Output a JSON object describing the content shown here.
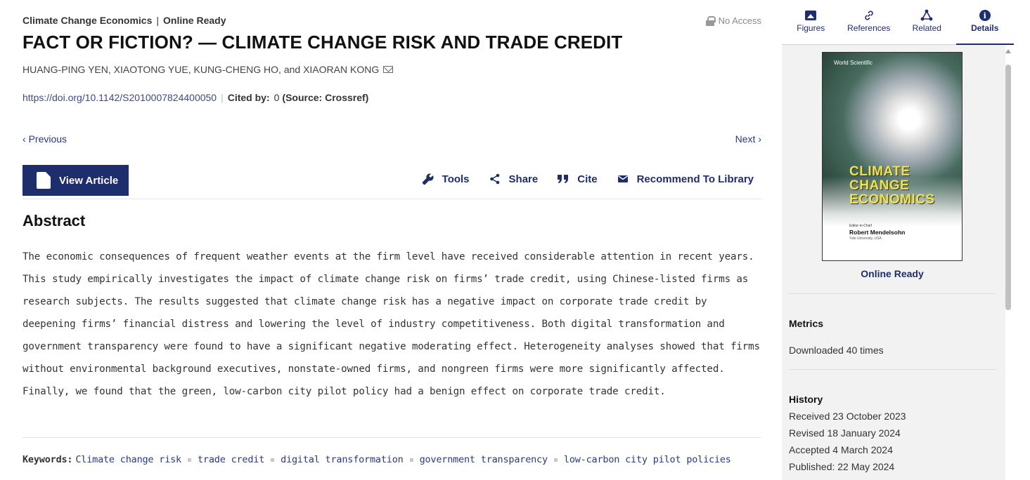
{
  "header": {
    "journal": "Climate Change Economics",
    "separator": "|",
    "status": "Online Ready",
    "access": "No Access"
  },
  "article": {
    "title": "FACT OR FICTION? — CLIMATE CHANGE RISK AND TRADE CREDIT",
    "authors": "HUANG-PING YEN, XIAOTONG YUE, KUNG-CHENG HO, and XIAORAN KONG",
    "doi": "https://doi.org/10.1142/S2010007824400050",
    "cited_by_label": "Cited by:",
    "cited_by_count": "0",
    "cited_by_source": "(Source: Crossref)"
  },
  "nav": {
    "previous": "Previous",
    "next": "Next"
  },
  "actions": {
    "view_article": "View Article",
    "tools": "Tools",
    "share": "Share",
    "cite": "Cite",
    "recommend": "Recommend To Library"
  },
  "abstract": {
    "heading": "Abstract",
    "text": "The economic consequences of frequent weather events at the firm level have received considerable attention in recent years. This study empirically investigates the impact of climate change risk on firms’ trade credit, using Chinese-listed firms as research subjects. The results suggested that climate change risk has a negative impact on corporate trade credit by deepening firms’ financial distress and lowering the level of industry competitiveness. Both digital transformation and government transparency were found to have a significant negative moderating effect. Heterogeneity analyses showed that firms without environmental background executives, nonstate-owned firms, and nongreen firms were more significantly affected. Finally, we found that the green, low-carbon city pilot policy had a benign effect on corporate trade credit."
  },
  "keywords": {
    "label": "Keywords:",
    "items": [
      "Climate change risk",
      "trade credit",
      "digital transformation",
      "government transparency",
      "low-carbon city pilot policies"
    ]
  },
  "sidebar": {
    "tabs": [
      {
        "label": "Figures",
        "icon": "image-icon"
      },
      {
        "label": "References",
        "icon": "link-icon"
      },
      {
        "label": "Related",
        "icon": "network-icon"
      },
      {
        "label": "Details",
        "icon": "info-icon"
      }
    ],
    "cover": {
      "publisher": "World Scientific",
      "title_lines": [
        "CLIMATE",
        "CHANGE",
        "ECONOMICS"
      ],
      "editor_label": "Editor-in-Chief",
      "editor": "Robert Mendelsohn",
      "affiliation": "Yale University, USA"
    },
    "online_ready": "Online Ready",
    "metrics_heading": "Metrics",
    "downloaded": "Downloaded 40 times",
    "history_heading": "History",
    "history": [
      "Received 23 October 2023",
      "Revised 18 January 2024",
      "Accepted 4 March 2024",
      "Published: 22 May 2024"
    ]
  },
  "colors": {
    "accent": "#1e2d6b",
    "link": "#3a4a8a",
    "panel_bg": "#f2f2f2"
  }
}
